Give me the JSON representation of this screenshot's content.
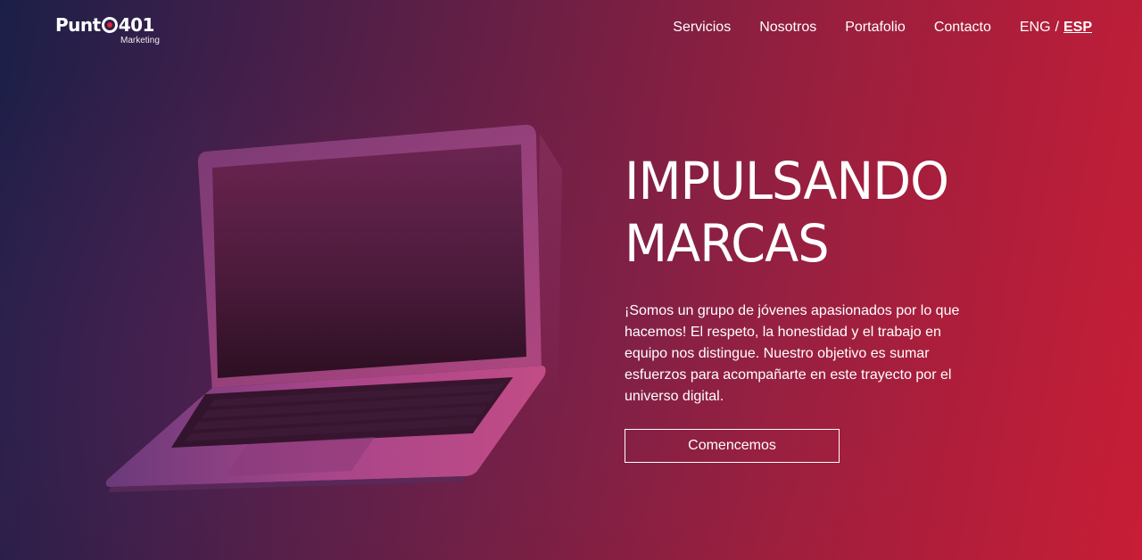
{
  "brand": {
    "name_left": "Punt",
    "name_right": "401",
    "tagline": "Marketing",
    "accent_color": "#e0213a"
  },
  "nav": {
    "items": [
      {
        "label": "Servicios"
      },
      {
        "label": "Nosotros"
      },
      {
        "label": "Portafolio"
      },
      {
        "label": "Contacto"
      }
    ],
    "languages": {
      "eng": "ENG",
      "separator": "/",
      "esp": "ESP",
      "active": "ESP"
    }
  },
  "hero": {
    "title_line1": "IMPULSANDO",
    "title_line2": "MARCAS",
    "description": "¡Somos un grupo de jóvenes apasionados por lo que hacemos! El respeto, la honestidad y el trabajo en equipo nos distingue. Nuestro objetivo es sumar esfuerzos para acompañarte en este trayecto por el universo digital.",
    "cta_label": "Comencemos",
    "image": "laptop-illustration"
  },
  "colors": {
    "gradient_start": "#1b1f48",
    "gradient_end": "#c81d36",
    "text": "#ffffff"
  }
}
